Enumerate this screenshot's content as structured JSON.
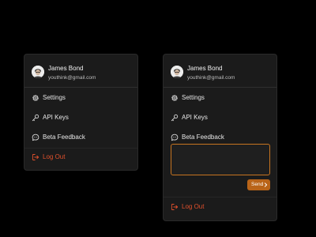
{
  "user": {
    "name": "James Bond",
    "email": "youthink@gmail.com"
  },
  "menu": {
    "settings_label": "Settings",
    "api_keys_label": "API Keys",
    "beta_feedback_label": "Beta Feedback",
    "logout_label": "Log Out"
  },
  "feedback": {
    "value": "",
    "send_label": "Send"
  },
  "colors": {
    "accent": "#c77420",
    "logout": "#e0502c",
    "panel": "#1b1b1b",
    "background": "#000000"
  },
  "icons": {
    "settings": "gear-icon",
    "api_keys": "key-icon",
    "beta_feedback": "chat-bubble-icon",
    "logout": "logout-icon",
    "send": "chevron-right-icon"
  }
}
